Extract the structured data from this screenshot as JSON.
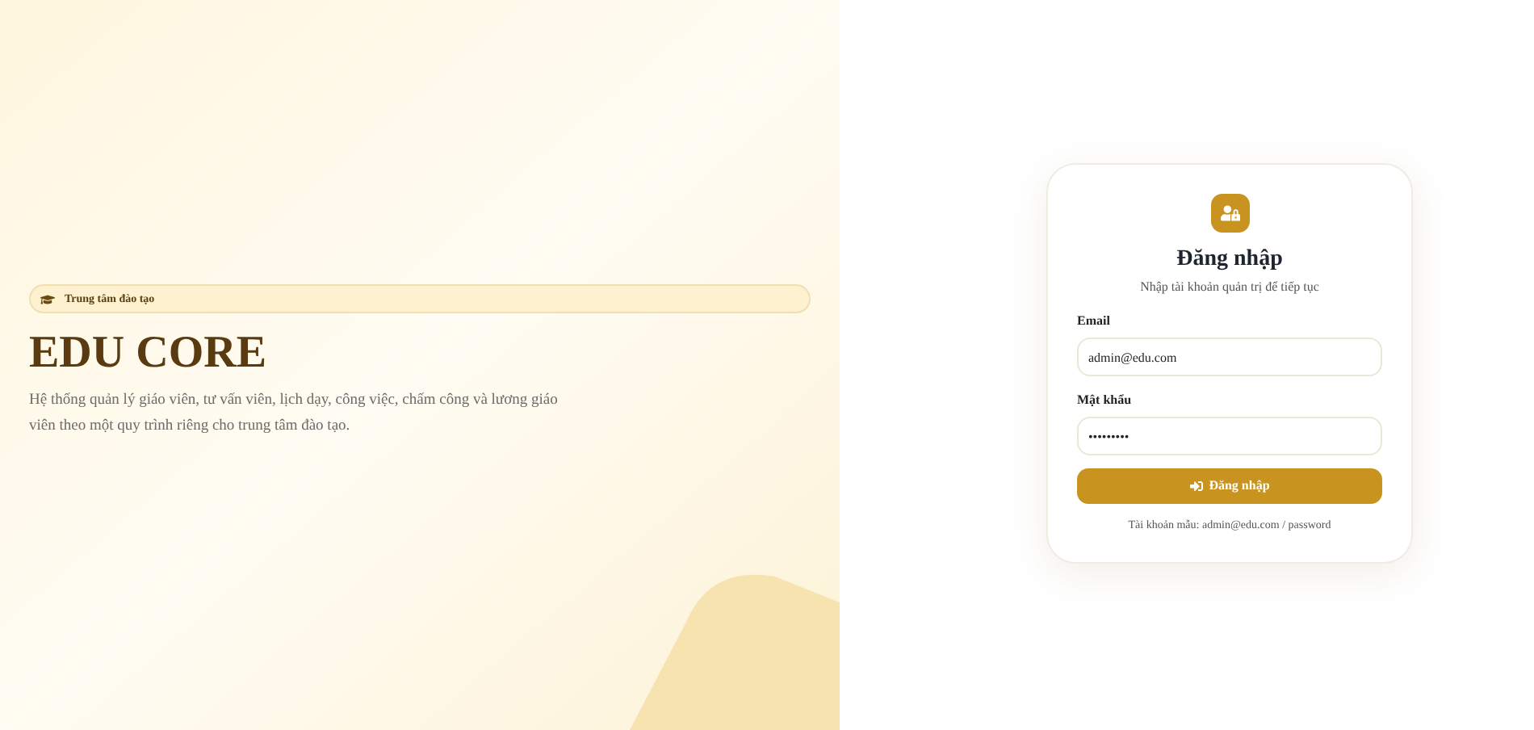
{
  "hero": {
    "badge": "Trung tâm đào tạo",
    "title": "EDU CORE",
    "description": "Hệ thống quản lý giáo viên, tư vấn viên, lịch dạy, công việc, chấm công và lương giáo viên theo một quy trình riêng cho trung tâm đào tạo."
  },
  "login": {
    "title": "Đăng nhập",
    "subtitle": "Nhập tài khoản quản trị để tiếp tục",
    "fields": [
      {
        "label": "Email",
        "value": "admin@edu.com"
      },
      {
        "label": "Mật khẩu",
        "value": "•••••••••"
      }
    ],
    "submit": "Đăng nhập",
    "hint": "Tài khoản mẫu: admin@edu.com / password"
  }
}
